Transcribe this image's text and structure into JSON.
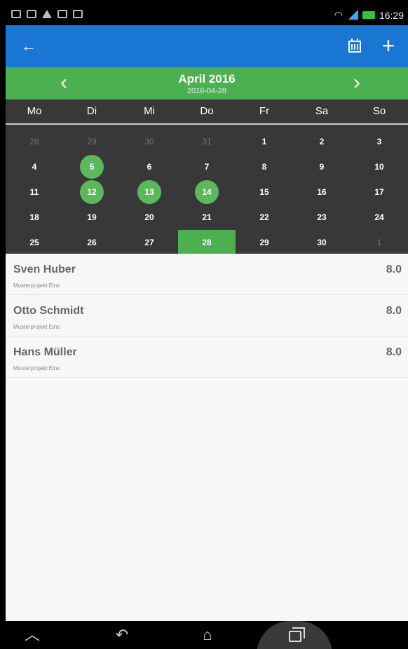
{
  "status_bar": {
    "time": "16:29"
  },
  "month": {
    "title": "April 2016",
    "date": "2016-04-28",
    "prev_glyph": "‹",
    "next_glyph": "›"
  },
  "weekdays": [
    "Mo",
    "Di",
    "Mi",
    "Do",
    "Fr",
    "Sa",
    "So"
  ],
  "weeks": [
    [
      {
        "d": "28",
        "dim": true
      },
      {
        "d": "29",
        "dim": true
      },
      {
        "d": "30",
        "dim": true
      },
      {
        "d": "31",
        "dim": true
      },
      {
        "d": "1"
      },
      {
        "d": "2"
      },
      {
        "d": "3"
      }
    ],
    [
      {
        "d": "4"
      },
      {
        "d": "5",
        "mark": true
      },
      {
        "d": "6"
      },
      {
        "d": "7"
      },
      {
        "d": "8"
      },
      {
        "d": "9"
      },
      {
        "d": "10"
      }
    ],
    [
      {
        "d": "11"
      },
      {
        "d": "12",
        "mark": true
      },
      {
        "d": "13",
        "mark": true
      },
      {
        "d": "14",
        "mark": true
      },
      {
        "d": "15"
      },
      {
        "d": "16"
      },
      {
        "d": "17"
      }
    ],
    [
      {
        "d": "18"
      },
      {
        "d": "19"
      },
      {
        "d": "20"
      },
      {
        "d": "21"
      },
      {
        "d": "22"
      },
      {
        "d": "23"
      },
      {
        "d": "24"
      }
    ],
    [
      {
        "d": "25"
      },
      {
        "d": "26"
      },
      {
        "d": "27"
      },
      {
        "d": "28",
        "selected": true
      },
      {
        "d": "29"
      },
      {
        "d": "30"
      },
      {
        "d": "1",
        "dim": true
      }
    ]
  ],
  "entries": [
    {
      "name": "Sven Huber",
      "project": "Musterprojekt Eins",
      "hours": "8.0"
    },
    {
      "name": "Otto Schmidt",
      "project": "Musterprojekt Eins",
      "hours": "8.0"
    },
    {
      "name": "Hans Müller",
      "project": "Musterprojekt Eins",
      "hours": "8.0"
    }
  ],
  "colors": {
    "appbar": "#1976d2",
    "accent_green": "#4caf50",
    "calendar_bg": "#383838"
  },
  "icons": {
    "back": "arrow-left-icon",
    "calendar": "calendar-icon",
    "add": "plus-icon"
  }
}
